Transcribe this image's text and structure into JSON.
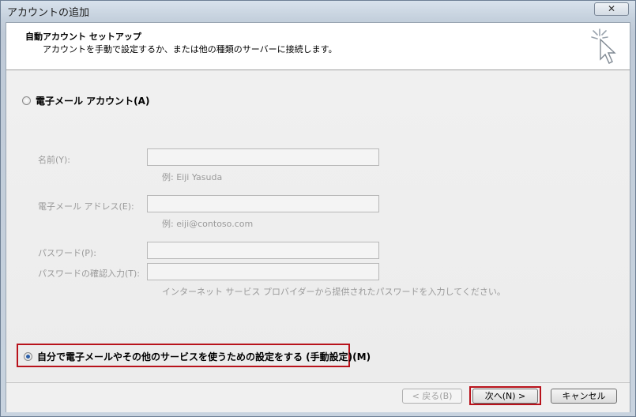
{
  "window": {
    "title": "アカウントの追加",
    "close_glyph": "✕"
  },
  "header": {
    "title": "自動アカウント セットアップ",
    "subtitle": "アカウントを手動で設定するか、または他の種類のサーバーに接続します。",
    "icon": "wizard-cursor-icon"
  },
  "options": {
    "email_account_label": "電子メール アカウント(A)",
    "email_account_checked": false,
    "manual_setup_label": "自分で電子メールやその他のサービスを使うための設定をする (手動設定)(M)",
    "manual_setup_checked": true
  },
  "form": {
    "name_label": "名前(Y):",
    "name_value": "",
    "name_hint": "例: Eiji Yasuda",
    "email_label": "電子メール アドレス(E):",
    "email_value": "",
    "email_hint": "例: eiji@contoso.com",
    "password_label": "パスワード(P):",
    "password_value": "",
    "password_confirm_label": "パスワードの確認入力(T):",
    "password_confirm_value": "",
    "password_hint": "インターネット サービス プロバイダーから提供されたパスワードを入力してください。"
  },
  "footer": {
    "back_label": "< 戻る(B)",
    "next_label": "次へ(N) >",
    "cancel_label": "キャンセル"
  },
  "colors": {
    "highlight": "#b8121b",
    "radio_selected": "#2c5fa8"
  }
}
